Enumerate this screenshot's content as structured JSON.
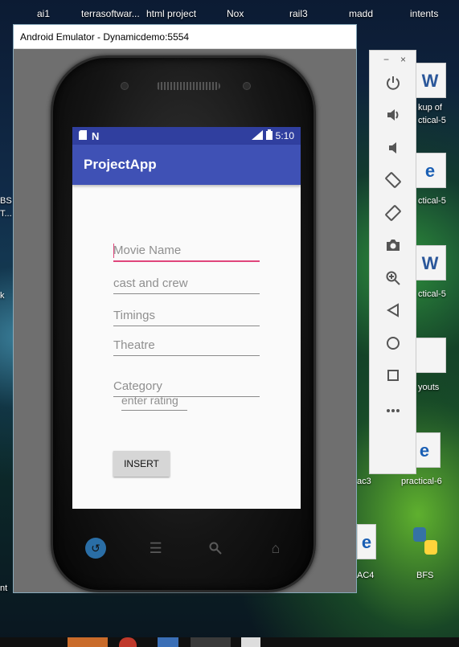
{
  "desktop": {
    "top_labels": [
      "ai1",
      "terrasoftwar...",
      "html project",
      "Nox",
      "rail3",
      "madd",
      "intents"
    ],
    "right_labels": {
      "r1": "kup of",
      "r2": "ctical-5",
      "r3": "ctical-5",
      "r4": "ctical-5",
      "r5": "youts",
      "r6": "practical-6",
      "r7": "ac3",
      "r8": "AC4",
      "r9": "BFS"
    },
    "left_labels": {
      "l1": "BS",
      "l2": "T...",
      "l3": "k",
      "l4": "nt"
    }
  },
  "emulator": {
    "window_title": "Android Emulator - Dynamicdemo:5554",
    "status_time": "5:10",
    "app_title": "ProjectApp",
    "fields": {
      "movie_name": {
        "placeholder": "Movie Name",
        "value": ""
      },
      "cast_crew": {
        "placeholder": "cast and crew",
        "value": ""
      },
      "timings": {
        "placeholder": "Timings",
        "value": ""
      },
      "theatre": {
        "placeholder": "Theatre",
        "value": ""
      },
      "category": {
        "placeholder": "Category",
        "value": ""
      },
      "rating": {
        "placeholder": "enter rating",
        "value": ""
      }
    },
    "insert_label": "INSERT"
  },
  "toolbar": {
    "minimize": "−",
    "close": "×",
    "buttons": [
      "power-icon",
      "volume-up-icon",
      "volume-down-icon",
      "rotate-left-icon",
      "rotate-right-icon",
      "camera-icon",
      "zoom-icon",
      "back-icon",
      "home-icon",
      "overview-icon",
      "more-icon"
    ]
  },
  "colors": {
    "status_bar": "#303f9f",
    "app_bar": "#3f51b5",
    "accent": "#e0457b"
  }
}
